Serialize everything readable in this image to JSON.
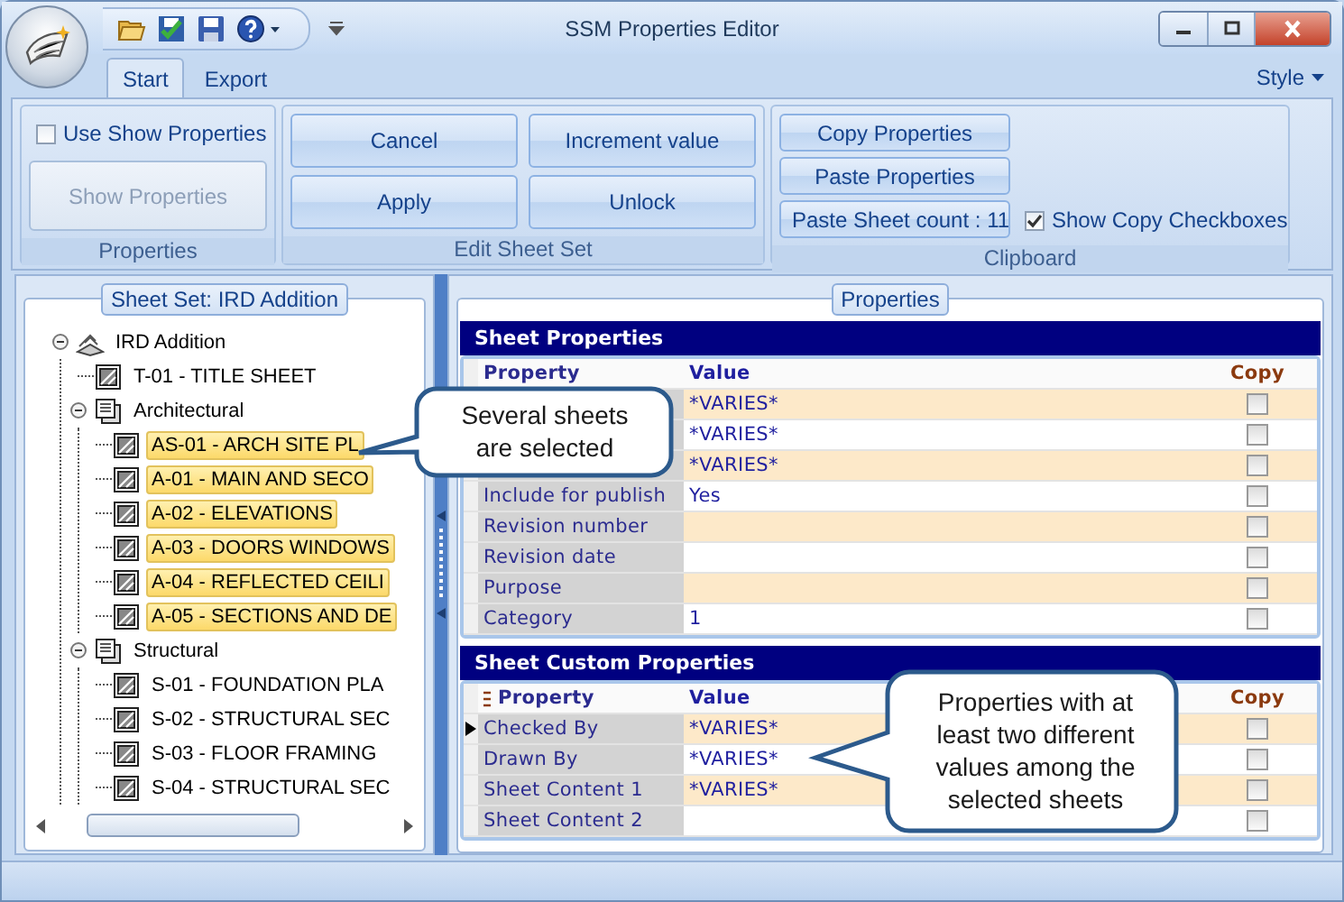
{
  "window": {
    "title": "SSM Properties Editor"
  },
  "ribbon_tabs": [
    {
      "label": "Start",
      "selected": true
    },
    {
      "label": "Export",
      "selected": false
    }
  ],
  "style_menu": {
    "label": "Style"
  },
  "properties_group": {
    "title": "Properties",
    "use_show_properties": {
      "label": "Use Show Properties",
      "checked": false
    },
    "show_properties_button": {
      "label": "Show Properties",
      "disabled": true
    }
  },
  "edit_group": {
    "title": "Edit Sheet Set",
    "buttons": [
      {
        "label": "Cancel"
      },
      {
        "label": "Increment value"
      },
      {
        "label": "Apply"
      },
      {
        "label": "Unlock"
      }
    ]
  },
  "clipboard_group": {
    "title": "Clipboard",
    "buttons": [
      {
        "label": "Copy Properties"
      },
      {
        "label": "Paste Properties"
      },
      {
        "label": "Paste Sheet count : 11"
      }
    ],
    "show_copy_checkboxes": {
      "label": "Show Copy Checkboxes",
      "checked": true
    }
  },
  "tree": {
    "title": "Sheet Set: IRD Addition",
    "items": [
      {
        "label": "IRD Addition",
        "kind": "sheet_set",
        "expanded": true,
        "selected": false,
        "children": [
          {
            "label": "T-01 - TITLE SHEET",
            "kind": "sheet",
            "selected": false
          },
          {
            "label": "Architectural",
            "kind": "subset",
            "expanded": true,
            "selected": false,
            "children": [
              {
                "label": "AS-01 - ARCH SITE PL",
                "kind": "sheet",
                "selected": true
              },
              {
                "label": "A-01 - MAIN AND SECO",
                "kind": "sheet",
                "selected": true
              },
              {
                "label": "A-02 - ELEVATIONS",
                "kind": "sheet",
                "selected": true
              },
              {
                "label": "A-03 - DOORS WINDOWS",
                "kind": "sheet",
                "selected": true
              },
              {
                "label": "A-04 - REFLECTED CEILI",
                "kind": "sheet",
                "selected": true
              },
              {
                "label": "A-05 - SECTIONS AND DE",
                "kind": "sheet",
                "selected": true
              }
            ]
          },
          {
            "label": "Structural",
            "kind": "subset",
            "expanded": true,
            "selected": false,
            "children": [
              {
                "label": "S-01 - FOUNDATION PLA",
                "kind": "sheet",
                "selected": false
              },
              {
                "label": "S-02 - STRUCTURAL SEC",
                "kind": "sheet",
                "selected": false
              },
              {
                "label": "S-03 - FLOOR FRAMING",
                "kind": "sheet",
                "selected": false
              },
              {
                "label": "S-04 - STRUCTURAL SEC",
                "kind": "sheet",
                "selected": false
              }
            ]
          }
        ]
      }
    ]
  },
  "properties": {
    "title": "Properties",
    "sections": [
      {
        "title": "Sheet Properties",
        "columns": [
          "Property",
          "Value",
          "Copy"
        ],
        "rows": [
          {
            "value": "*VARIES*",
            "copy": false
          },
          {
            "value": "*VARIES*",
            "copy": false
          },
          {
            "value": "*VARIES*",
            "copy": false
          },
          {
            "property": "Include for publish",
            "value": "Yes",
            "copy": false,
            "current": false
          },
          {
            "property": "Revision number",
            "copy": false,
            "current": false
          },
          {
            "property": "Revision date",
            "copy": false,
            "current": false
          },
          {
            "property": "Purpose",
            "copy": false,
            "current": false
          },
          {
            "property": "Category",
            "value": "1",
            "copy": false,
            "current": false
          }
        ]
      },
      {
        "title": "Sheet Custom Properties",
        "columns": [
          "Property",
          "Value",
          "Copy"
        ],
        "rows": [
          {
            "property": "Checked By",
            "value": "*VARIES*",
            "copy": false,
            "current": true
          },
          {
            "property": "Drawn By",
            "value": "*VARIES*",
            "copy": false,
            "current": false
          },
          {
            "property": "Sheet Content 1",
            "value": "*VARIES*",
            "copy": false,
            "current": false
          },
          {
            "property": "Sheet Content 2",
            "copy": false,
            "current": false
          }
        ]
      }
    ]
  },
  "callouts": [
    {
      "text": "Several sheets are selected"
    },
    {
      "text": "Properties with at least two different values among the selected sheets"
    }
  ]
}
